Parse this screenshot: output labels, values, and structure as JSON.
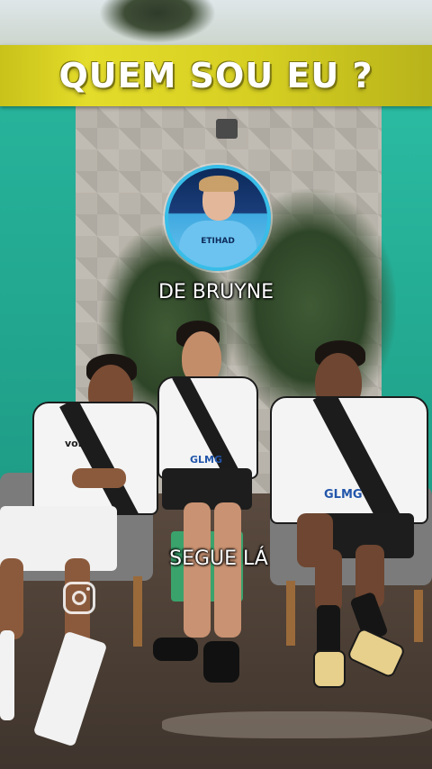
{
  "banner": {
    "title": "QUEM SOU EU ?"
  },
  "avatar": {
    "shirt_text": "ETIHAD"
  },
  "captions": {
    "player_name": "DE BRUYNE",
    "follow": "SEGUE LÁ"
  },
  "jerseys": {
    "sponsor_1": "GLMG",
    "sponsor_2": "GLMG",
    "brand": "volka"
  },
  "icons": {
    "social": "instagram-icon"
  },
  "colors": {
    "banner_yellow": "#d6cf22",
    "wall_teal": "#24ad96",
    "avatar_ring": "#38bde8"
  }
}
